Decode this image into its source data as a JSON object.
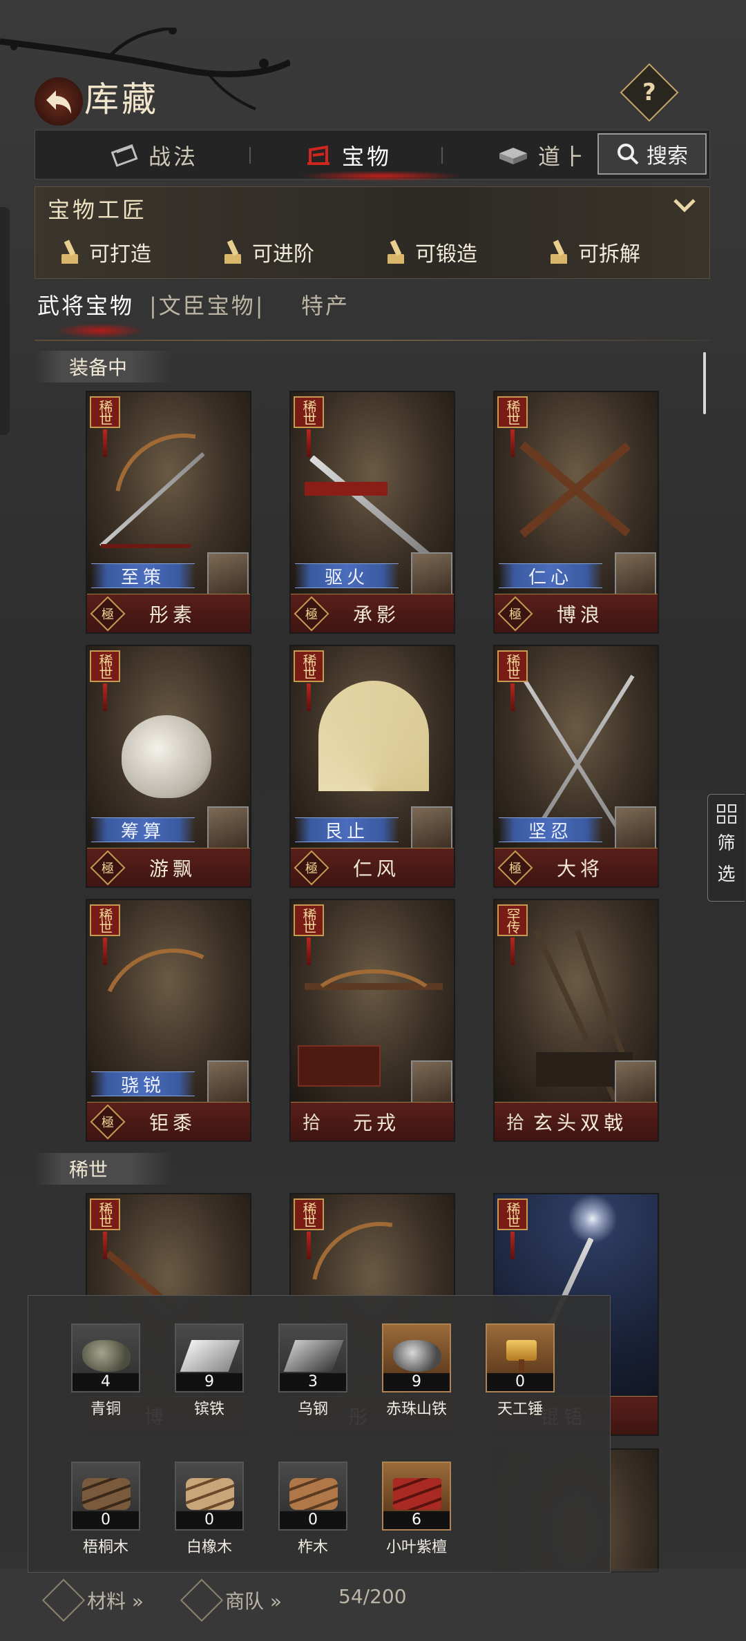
{
  "header": {
    "title": "库藏",
    "help_icon": "?"
  },
  "top_tabs": [
    {
      "label": "战法",
      "icon": "scroll-icon"
    },
    {
      "label": "宝物",
      "icon": "treasure-icon",
      "active": true
    },
    {
      "label": "道⺊",
      "icon": "item-icon"
    }
  ],
  "search": {
    "label": "搜索"
  },
  "artisan": {
    "title": "宝物工匠",
    "actions": [
      "可打造",
      "可进阶",
      "可锻造",
      "可拆解"
    ]
  },
  "categories": [
    {
      "label": "武将宝物",
      "active": true
    },
    {
      "label": "|文臣宝物|",
      "active": false
    },
    {
      "label": "特产",
      "active": false
    }
  ],
  "sections": {
    "equipped": "装备中",
    "rare": "稀世"
  },
  "filter": {
    "label_1": "筛",
    "label_2": "选"
  },
  "equipped_cards": [
    {
      "rarity": "稀世",
      "skill": "至策",
      "grade": "極",
      "name": "彤素"
    },
    {
      "rarity": "稀世",
      "skill": "驱火",
      "grade": "極",
      "name": "承影"
    },
    {
      "rarity": "稀世",
      "skill": "仁心",
      "grade": "極",
      "name": "博浪"
    },
    {
      "rarity": "稀世",
      "skill": "筹算",
      "grade": "極",
      "name": "游飘"
    },
    {
      "rarity": "稀世",
      "skill": "艮止",
      "grade": "極",
      "name": "仁风"
    },
    {
      "rarity": "稀世",
      "skill": "坚忍",
      "grade": "極",
      "name": "大将"
    },
    {
      "rarity": "稀世",
      "skill": "骁锐",
      "grade": "極",
      "name": "钜黍"
    },
    {
      "rarity": "稀世",
      "skill": "",
      "grade": "拾",
      "name": "元戎"
    },
    {
      "rarity": "罕传",
      "skill": "",
      "grade": "拾",
      "name": "玄头双戟"
    }
  ],
  "rare_cards": [
    {
      "rarity": "稀世",
      "name": "博"
    },
    {
      "rarity": "稀世",
      "name": "彤"
    },
    {
      "rarity": "稀世",
      "name": "锟铻"
    }
  ],
  "materials": [
    {
      "name": "青铜",
      "count": "4",
      "icon": "bronze-ore-icon"
    },
    {
      "name": "镔铁",
      "count": "9",
      "icon": "iron-ingot-icon"
    },
    {
      "name": "乌钢",
      "count": "3",
      "icon": "steel-ingot-icon"
    },
    {
      "name": "赤珠山铁",
      "count": "9",
      "icon": "red-iron-ore-icon"
    },
    {
      "name": "天工锤",
      "count": "0",
      "icon": "hammer-icon"
    },
    {
      "name": "梧桐木",
      "count": "0",
      "icon": "wutong-wood-icon"
    },
    {
      "name": "白橡木",
      "count": "0",
      "icon": "oak-wood-icon"
    },
    {
      "name": "柞木",
      "count": "0",
      "icon": "zuo-wood-icon"
    },
    {
      "name": "小叶紫檀",
      "count": "6",
      "icon": "rosewood-icon"
    }
  ],
  "bottom_bar": {
    "materials_label": "材料 »",
    "caravan_label": "商队 »",
    "capacity": "54/200"
  }
}
